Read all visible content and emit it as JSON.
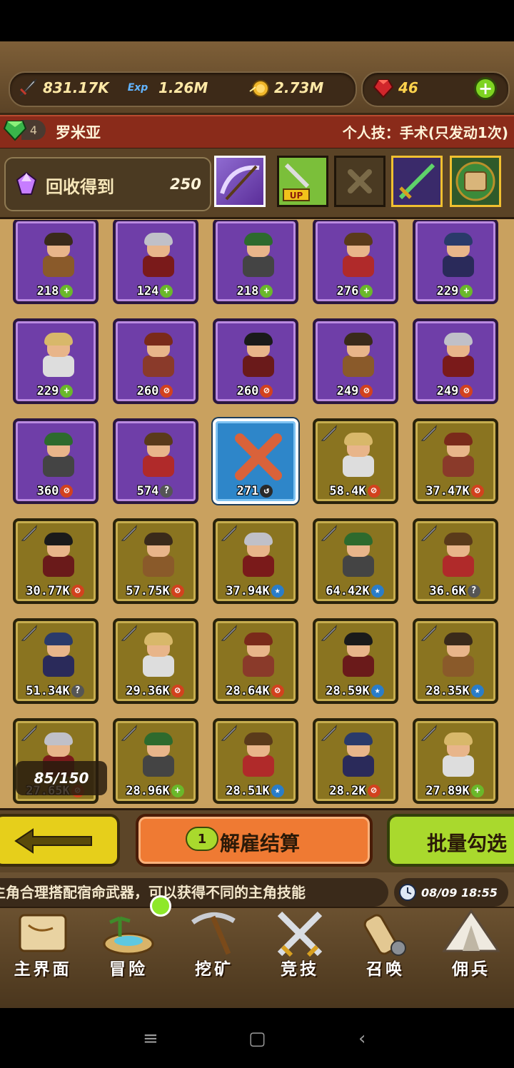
{
  "resources": {
    "attack": "831.17K",
    "exp_label": "Exp",
    "exp": "1.26M",
    "gold": "2.73M",
    "ruby": "46"
  },
  "hero": {
    "level": "4",
    "name": "罗米亚",
    "skill": "个人技：手术(只发动1次)"
  },
  "recycle": {
    "label": "回收得到",
    "value": "250"
  },
  "equipment_slots": [
    {
      "name": "scythe-weapon-icon",
      "selected": true
    },
    {
      "name": "sword-up-icon"
    },
    {
      "name": "empty-slot-x-icon"
    },
    {
      "name": "green-sword-icon"
    },
    {
      "name": "scroll-map-icon"
    }
  ],
  "mercenaries": [
    {
      "level": "218",
      "mark": "plus",
      "rarity": "purple"
    },
    {
      "level": "124",
      "mark": "plus",
      "rarity": "purple"
    },
    {
      "level": "218",
      "mark": "plus",
      "rarity": "purple"
    },
    {
      "level": "276",
      "mark": "plus",
      "rarity": "purple"
    },
    {
      "level": "229",
      "mark": "plus",
      "rarity": "purple"
    },
    {
      "level": "229",
      "mark": "plus",
      "rarity": "purple"
    },
    {
      "level": "260",
      "mark": "slash",
      "rarity": "purple"
    },
    {
      "level": "260",
      "mark": "slash",
      "rarity": "purple"
    },
    {
      "level": "249",
      "mark": "slash",
      "rarity": "purple"
    },
    {
      "level": "249",
      "mark": "slash",
      "rarity": "purple"
    },
    {
      "level": "360",
      "mark": "slash",
      "rarity": "purple"
    },
    {
      "level": "574",
      "mark": "question",
      "rarity": "purple"
    },
    {
      "level": "271",
      "mark": "arrow",
      "rarity": "blue",
      "selected": true
    },
    {
      "level": "58.4K",
      "mark": "slash",
      "rarity": "gold"
    },
    {
      "level": "37.47K",
      "mark": "slash",
      "rarity": "gold"
    },
    {
      "level": "30.77K",
      "mark": "slash",
      "rarity": "gold"
    },
    {
      "level": "57.75K",
      "mark": "slash",
      "rarity": "gold"
    },
    {
      "level": "37.94K",
      "mark": "star",
      "rarity": "gold"
    },
    {
      "level": "64.42K",
      "mark": "star",
      "rarity": "gold"
    },
    {
      "level": "36.6K",
      "mark": "question",
      "rarity": "gold"
    },
    {
      "level": "51.34K",
      "mark": "question",
      "rarity": "gold"
    },
    {
      "level": "29.36K",
      "mark": "slash",
      "rarity": "gold"
    },
    {
      "level": "28.64K",
      "mark": "slash",
      "rarity": "gold"
    },
    {
      "level": "28.59K",
      "mark": "star",
      "rarity": "gold"
    },
    {
      "level": "28.35K",
      "mark": "star",
      "rarity": "gold"
    },
    {
      "level": "27.65K",
      "mark": "slash",
      "rarity": "gold"
    },
    {
      "level": "28.96K",
      "mark": "plus",
      "rarity": "gold"
    },
    {
      "level": "28.51K",
      "mark": "star",
      "rarity": "gold"
    },
    {
      "level": "28.2K",
      "mark": "slash",
      "rarity": "gold"
    },
    {
      "level": "27.89K",
      "mark": "plus",
      "rarity": "gold"
    }
  ],
  "counter": "85/150",
  "actions": {
    "dismiss_badge": "1",
    "dismiss_label": "解雇结算",
    "batch_label": "批量勾选"
  },
  "ticker": "主角合理搭配宿命武器，可以获得不同的主角技能",
  "clock": "08/09 18:55",
  "nav": [
    {
      "label": "主界面",
      "icon": "map-scroll-icon"
    },
    {
      "label": "冒险",
      "icon": "island-icon"
    },
    {
      "label": "挖矿",
      "icon": "pickaxe-icon"
    },
    {
      "label": "竞技",
      "icon": "crossed-swords-icon"
    },
    {
      "label": "召唤",
      "icon": "summon-scroll-icon"
    },
    {
      "label": "佣兵",
      "icon": "tent-icon"
    }
  ],
  "colors": {
    "purple_card": "#6f3ea8",
    "gold_card": "#8a7420",
    "blue_card": "#2e86c9",
    "dismiss_button": "#ef7a33",
    "batch_button": "#a9d92d",
    "back_button": "#e6cf1b"
  }
}
